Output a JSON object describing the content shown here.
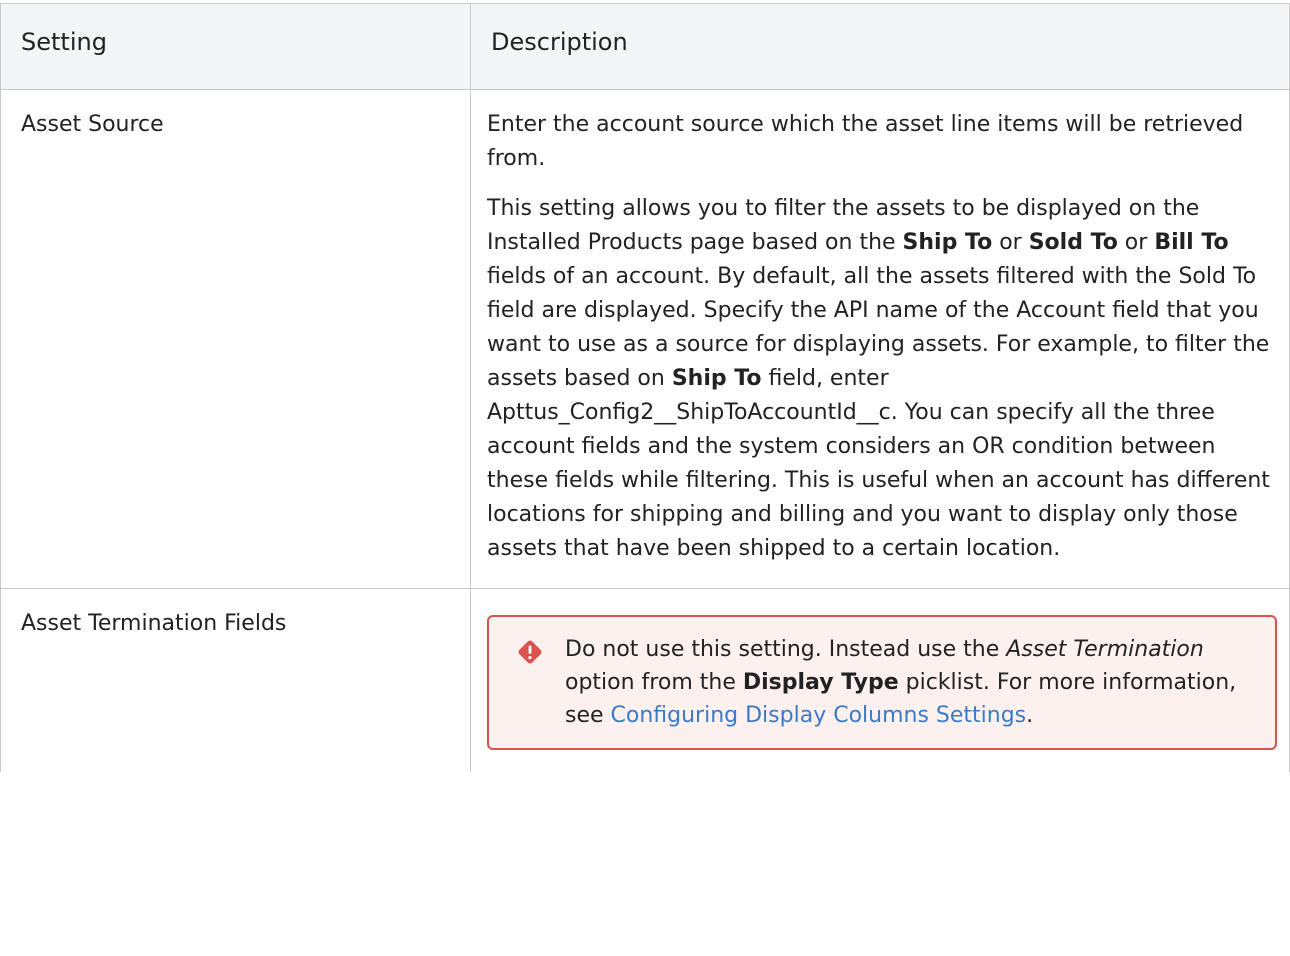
{
  "table": {
    "headers": {
      "setting": "Setting",
      "description": "Description"
    },
    "rows": [
      {
        "setting": "Asset Source",
        "p1": "Enter the account source which the asset line items will be retrieved from.",
        "p2": {
          "t1": "This setting allows you to filter the assets to be displayed on the Installed Products page based on the ",
          "b1": "Ship To",
          "t2": " or ",
          "b2": "Sold To",
          "t3": " or ",
          "b3": "Bill To",
          "t4": " fields of an account. By default, all the assets filtered with the Sold To field are displayed. Specify the API name of the Account field that you want to use as a source for displaying assets. For example, to filter the assets based on ",
          "b4": "Ship To",
          "t5": " field, enter Apttus_Config2__ShipToAccountId__c. You can specify all the three account fields and the system considers an OR condition between these fields while filtering. This is useful when an account has different locations for shipping and billing and you want to display only those assets that have been shipped to a certain location."
        }
      },
      {
        "setting": "Asset Termination Fields",
        "callout": {
          "icon": "warning-diamond-icon",
          "color": "#d9534f",
          "t1": "Do not use this setting. Instead use the ",
          "i1": "Asset Termination",
          "t2": " option from the ",
          "b1": "Display Type",
          "t3": " picklist. For more information, see ",
          "link": "Configuring Display Columns Settings",
          "t4": "."
        }
      }
    ]
  }
}
